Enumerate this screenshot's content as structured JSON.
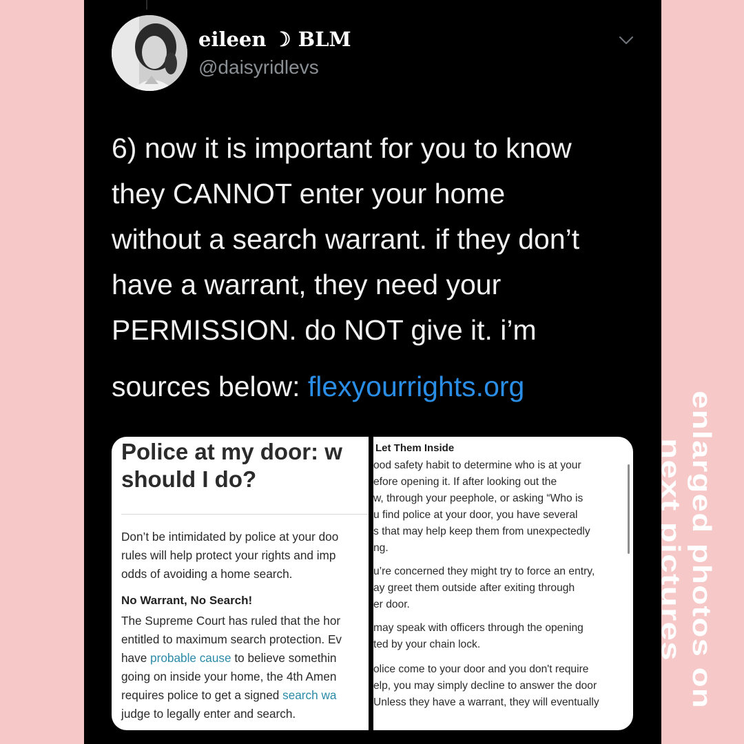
{
  "tweet": {
    "display_name": "eileen ☽ BLM",
    "handle": "@daisyridlevs",
    "menu_icon": "chevron-down-icon",
    "body_lines": [
      "6) now it is important for you to know",
      "they CANNOT enter your home",
      "without a search warrant. if they don’t",
      "have a warrant, they need your",
      "PERMISSION. do NOT give it. i’m"
    ],
    "sources_prefix": "sources below: ",
    "sources_link": "flexyourrights.org"
  },
  "left_panel": {
    "heading_line1": "Police at my door: w",
    "heading_line2": "should I do?",
    "intro_lines": [
      "Don’t be intimidated by police at your doo",
      "rules will help protect your rights and imp",
      "odds of avoiding a home search."
    ],
    "subheading": "No Warrant, No Search!",
    "para": {
      "l1": "The Supreme Court has ruled that the hor",
      "l2": "entitled to maximum search protection. Ev",
      "l3_pre": "have ",
      "l3_link": "probable cause",
      "l3_post": " to believe somethin",
      "l4": "going on inside your home, the 4th Amen",
      "l5_pre": "requires police to get a signed ",
      "l5_link": "search wa",
      "l6": "judge to legally enter and search."
    }
  },
  "right_panel": {
    "heading": "Let Them Inside",
    "block1": [
      "ood safety habit to determine who is at your",
      "efore opening it. If after looking out the",
      "w, through your peephole, or asking “Who is",
      "u find police at your door, you have several",
      "s that may help keep them from unexpectedly",
      "ng."
    ],
    "block2": [
      "u’re concerned they might try to force an entry,",
      "ay greet them outside after exiting through",
      "er door."
    ],
    "block3": [
      "may speak with officers through the opening",
      "ted by your chain lock."
    ],
    "block4": [
      "olice come to your door and you don't require",
      "elp, you may simply decline to answer the door",
      "Unless they have a warrant, they will eventually"
    ]
  },
  "side_caption": {
    "line1": "enlarged photos on",
    "line2": "next pictures",
    "color": "#ffffff"
  },
  "colors": {
    "background_pink": "#f7c8c8",
    "link_blue": "#2b8ee6",
    "inline_link_teal": "#2b8aa8"
  }
}
